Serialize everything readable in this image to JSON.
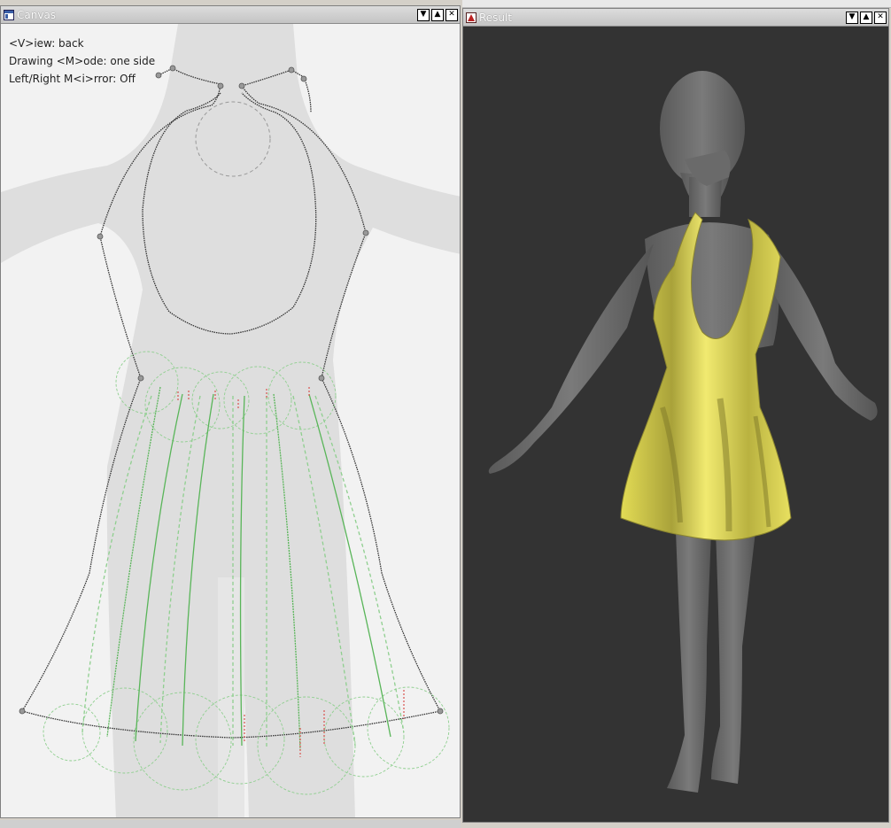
{
  "canvas_window": {
    "title": "Canvas",
    "icon": "window-app-icon",
    "controls": [
      "minimize",
      "maximize",
      "close"
    ],
    "overlay": {
      "view": "<V>iew: back",
      "mode": "Drawing <M>ode: one side",
      "mirror": "Left/Right M<i>rror: Off"
    }
  },
  "result_window": {
    "title": "Result",
    "icon": "window-app-icon",
    "controls": [
      "minimize",
      "maximize",
      "close"
    ]
  },
  "colors": {
    "background_3d": "#333333",
    "dress": "#e8e05a",
    "model": "#6e6e6e",
    "pattern_outline": "#333333",
    "fold_lines": "#5cb85c",
    "fold_marks": "#d9534f"
  },
  "icons": {
    "minimize": "triangle-down-icon",
    "maximize": "triangle-up-icon",
    "close": "close-icon"
  }
}
